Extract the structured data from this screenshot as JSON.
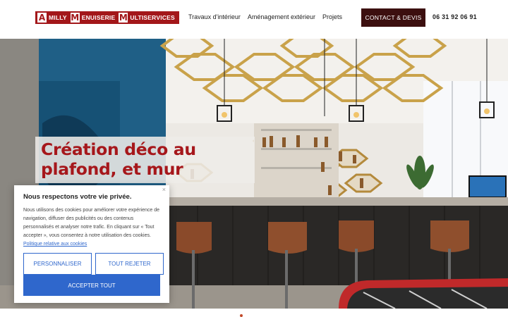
{
  "brand": {
    "parts": [
      {
        "initial": "A",
        "rest": "MILLY"
      },
      {
        "initial": "M",
        "rest": "ENUISERIE"
      },
      {
        "initial": "M",
        "rest": "ULTISERVICES"
      }
    ],
    "accent_color": "#a3171a"
  },
  "nav": {
    "items": [
      "Travaux d'intérieur",
      "Aménagement extérieur",
      "Projets"
    ],
    "cta_label": "CONTACT & DEVIS",
    "phone": "06 31 92 06 91",
    "cta_color": "#3c0f0f"
  },
  "hero": {
    "headline_line1": "Création déco au",
    "headline_line2": "plafond, et mur",
    "headline_color": "#a6171b"
  },
  "cookie": {
    "title": "Nous respectons votre vie privée.",
    "body": "Nous utilisons des cookies pour améliorer votre expérience de navigation, diffuser des publicités ou des contenus personnalisés et analyser notre trafic. En cliquant sur « Tout accepter », vous consentez à notre utilisation des cookies.",
    "policy_link": "Politique relative aux cookies",
    "close_icon": "×",
    "btn_customize": "PERSONNALISER",
    "btn_reject": "TOUT REJETER",
    "btn_accept": "ACCEPTER TOUT",
    "button_color": "#2f67cc"
  }
}
